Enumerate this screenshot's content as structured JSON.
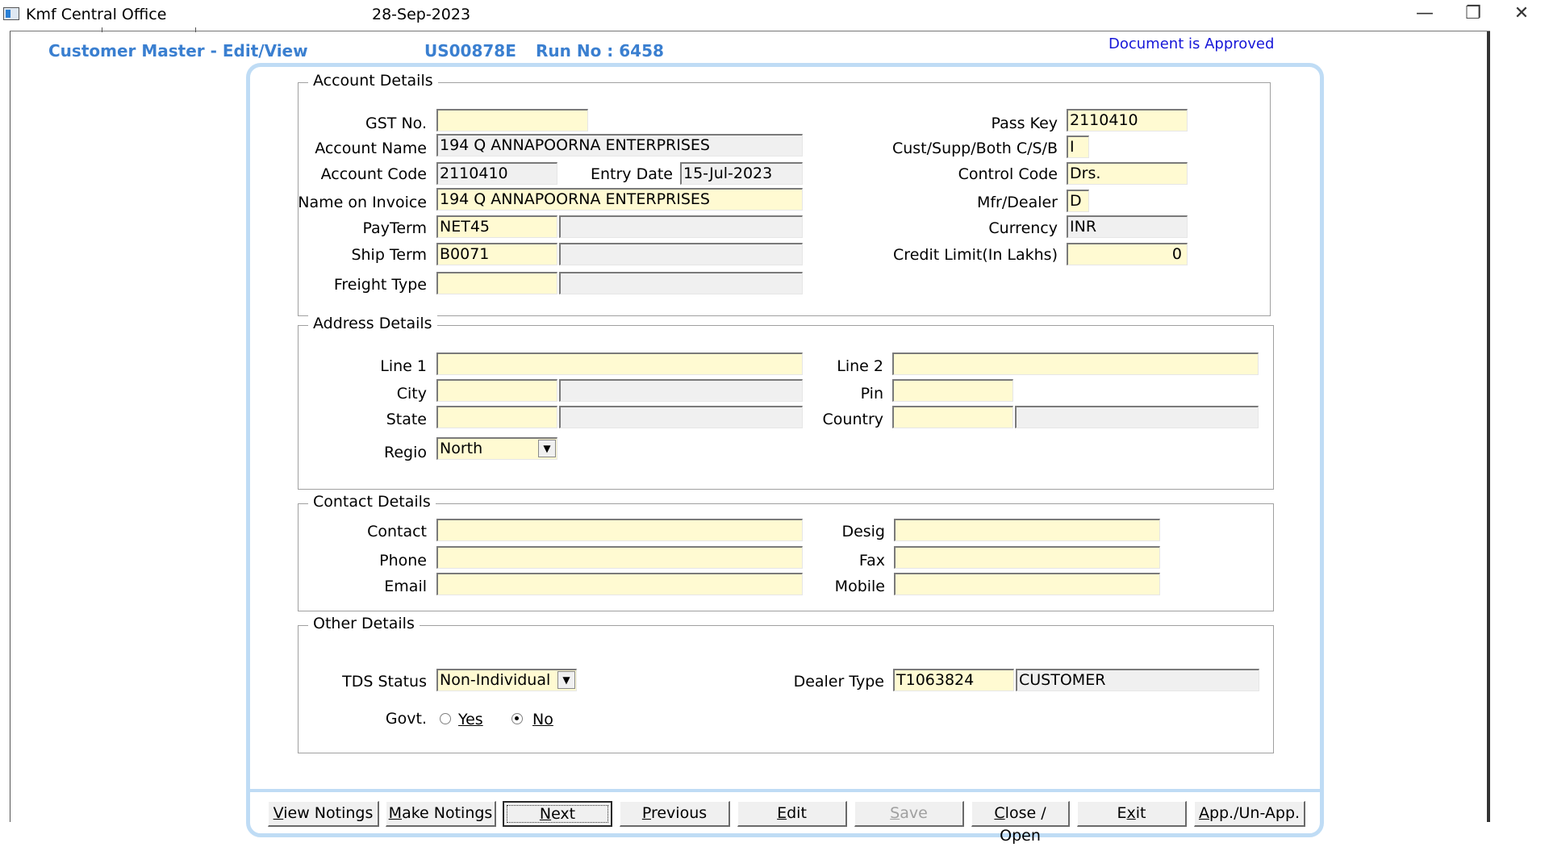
{
  "window": {
    "app_title": "Kmf Central Office",
    "date": "28-Sep-2023",
    "minimize_icon": "minimize-icon",
    "restore_icon": "restore-icon",
    "close_icon": "close-icon"
  },
  "header": {
    "form_title": "Customer Master - Edit/View",
    "doc_code": "US00878E",
    "run_no": "Run No : 6458",
    "approval_status": "Document is Approved"
  },
  "account": {
    "legend": "Account Details",
    "gst_label": "GST No.",
    "gst_value": "",
    "account_name_label": "Account Name",
    "account_name_value": "194 Q ANNAPOORNA ENTERPRISES",
    "account_code_label": "Account Code",
    "account_code_value": "2110410",
    "entry_date_label": "Entry Date",
    "entry_date_value": "15-Jul-2023",
    "name_on_invoice_label": "Name on Invoice",
    "name_on_invoice_value": "194 Q ANNAPOORNA ENTERPRISES",
    "payterm_label": "PayTerm",
    "payterm_value": "NET45",
    "payterm_desc": "",
    "shipterm_label": "Ship Term",
    "shipterm_value": "B0071",
    "shipterm_desc": "",
    "freight_label": "Freight Type",
    "freight_value": "",
    "freight_desc": "",
    "passkey_label": "Pass Key",
    "passkey_value": "2110410",
    "custsupp_label": "Cust/Supp/Both C/S/B",
    "custsupp_value": "I",
    "control_code_label": "Control Code",
    "control_code_value": "Drs.",
    "mfr_dealer_label": "Mfr/Dealer",
    "mfr_dealer_value": "D",
    "currency_label": "Currency",
    "currency_value": "INR",
    "credit_limit_label": "Credit Limit(In Lakhs)",
    "credit_limit_value": "0"
  },
  "address": {
    "legend": "Address Details",
    "line1_label": "Line 1",
    "line1_value": "",
    "line2_label": "Line 2",
    "line2_value": "",
    "city_label": "City",
    "city_value": "",
    "city_desc": "",
    "pin_label": "Pin",
    "pin_value": "",
    "state_label": "State",
    "state_value": "",
    "state_desc": "",
    "country_label": "Country",
    "country_value": "",
    "country_desc": "",
    "region_label": "Regio",
    "region_value": "North"
  },
  "contact": {
    "legend": "Contact Details",
    "contact_label": "Contact",
    "contact_value": "",
    "desig_label": "Desig",
    "desig_value": "",
    "phone_label": "Phone",
    "phone_value": "",
    "fax_label": "Fax",
    "fax_value": "",
    "email_label": "Email",
    "email_value": "",
    "mobile_label": "Mobile",
    "mobile_value": ""
  },
  "other": {
    "legend": "Other Details",
    "tds_label": "TDS Status",
    "tds_value": "Non-Individual",
    "dealer_type_label": "Dealer Type",
    "dealer_type_code": "T1063824",
    "dealer_type_desc": "CUSTOMER",
    "govt_label": "Govt.",
    "govt_yes_label": "Yes",
    "govt_no_label": "No",
    "govt_selected": "No"
  },
  "buttons": {
    "view_notings_pre": "V",
    "view_notings_rest": "iew Notings",
    "make_notings_pre": "M",
    "make_notings_rest": "ake Notings",
    "next_pre": "N",
    "next_rest": "ext",
    "previous_pre": "P",
    "previous_rest": "revious",
    "edit_pre": "E",
    "edit_rest": "dit",
    "save_pre": "S",
    "save_rest": "ave",
    "close_open_pre": "C",
    "close_open_rest": "lose / Open",
    "exit_pre": "E",
    "exit_mid": "x",
    "exit_rest": "it",
    "approve_pre": "A",
    "approve_rest": "pp./Un-App."
  }
}
